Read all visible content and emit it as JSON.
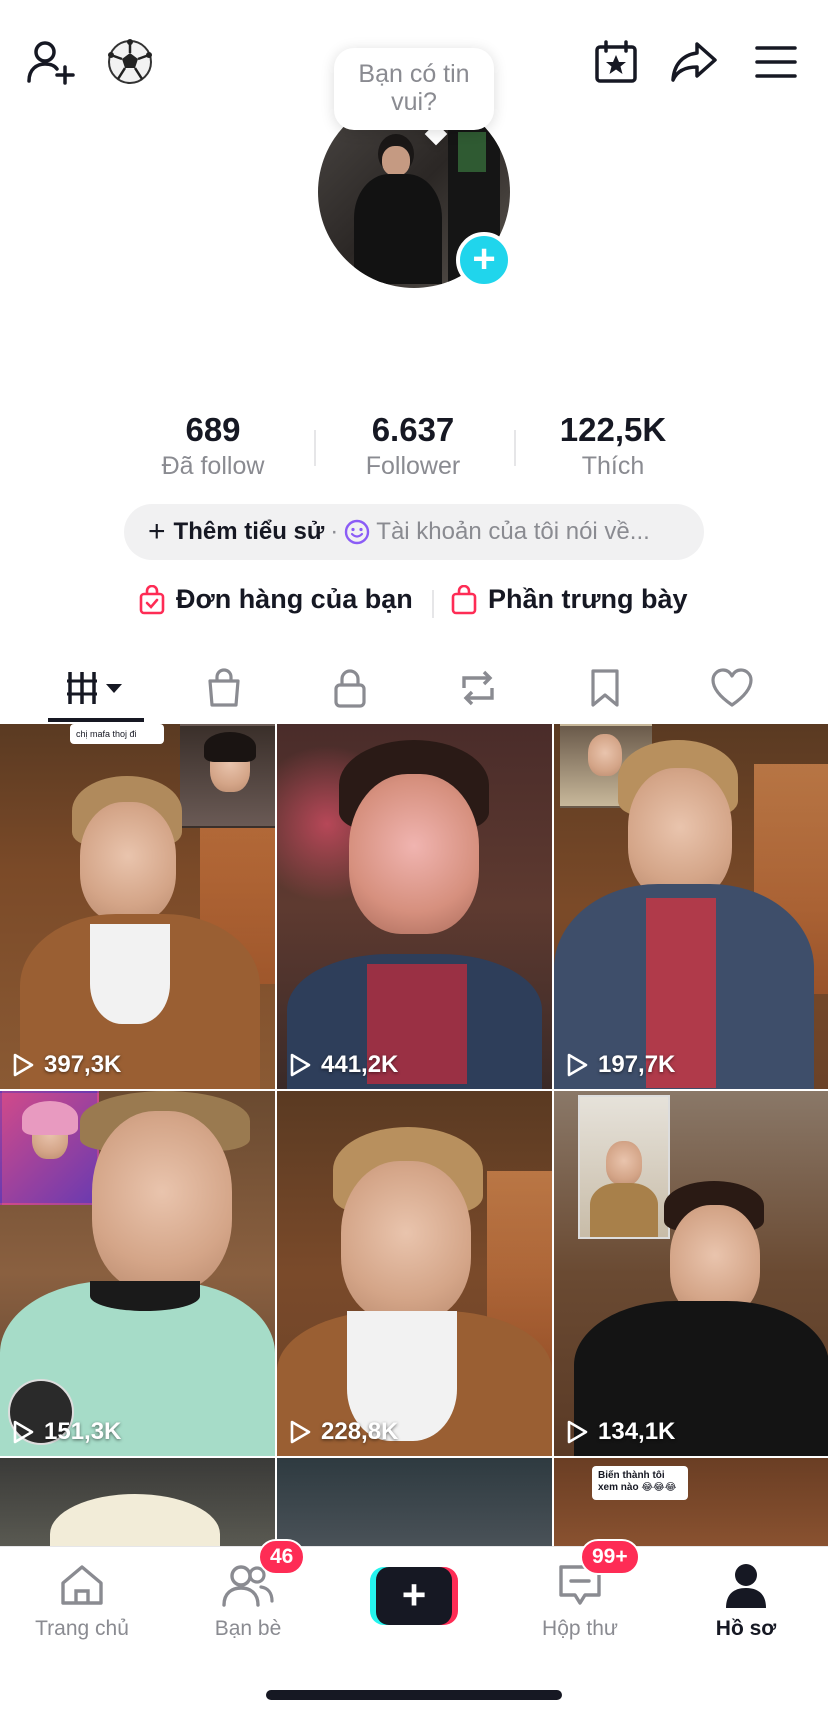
{
  "header": {
    "bubble_text_line1": "Bạn có tin",
    "bubble_text_line2": "vui?"
  },
  "stats": [
    {
      "value": "689",
      "label": "Đã follow"
    },
    {
      "value": "6.637",
      "label": "Follower"
    },
    {
      "value": "122,5K",
      "label": "Thích"
    }
  ],
  "bio": {
    "add_label": "Thêm tiểu sử",
    "separator": "·",
    "placeholder": "Tài khoản của tôi nói về..."
  },
  "shop": {
    "orders_label": "Đơn hàng của bạn",
    "showcase_label": "Phần trưng bày"
  },
  "tabs": [
    "videos-grid",
    "shop-bag",
    "private-lock",
    "repost",
    "favorites",
    "liked"
  ],
  "videos": [
    {
      "views": "397,3K",
      "caption": "chị mafa thoj đi"
    },
    {
      "views": "441,2K"
    },
    {
      "views": "197,7K"
    },
    {
      "views": "151,3K"
    },
    {
      "views": "228,8K"
    },
    {
      "views": "134,1K"
    },
    {
      "views": ""
    },
    {
      "views": ""
    },
    {
      "views": "",
      "caption": "Biến thành tôi xem nào 😂😂😂"
    }
  ],
  "nav": {
    "home": "Trang chủ",
    "friends": "Bạn bè",
    "friends_badge": "46",
    "inbox": "Hộp thư",
    "inbox_badge": "99+",
    "profile": "Hồ sơ"
  },
  "colors": {
    "accent_cyan": "#20d5ec",
    "accent_red": "#fe2c55",
    "text_primary": "#161823",
    "text_secondary": "#8a8b91"
  }
}
